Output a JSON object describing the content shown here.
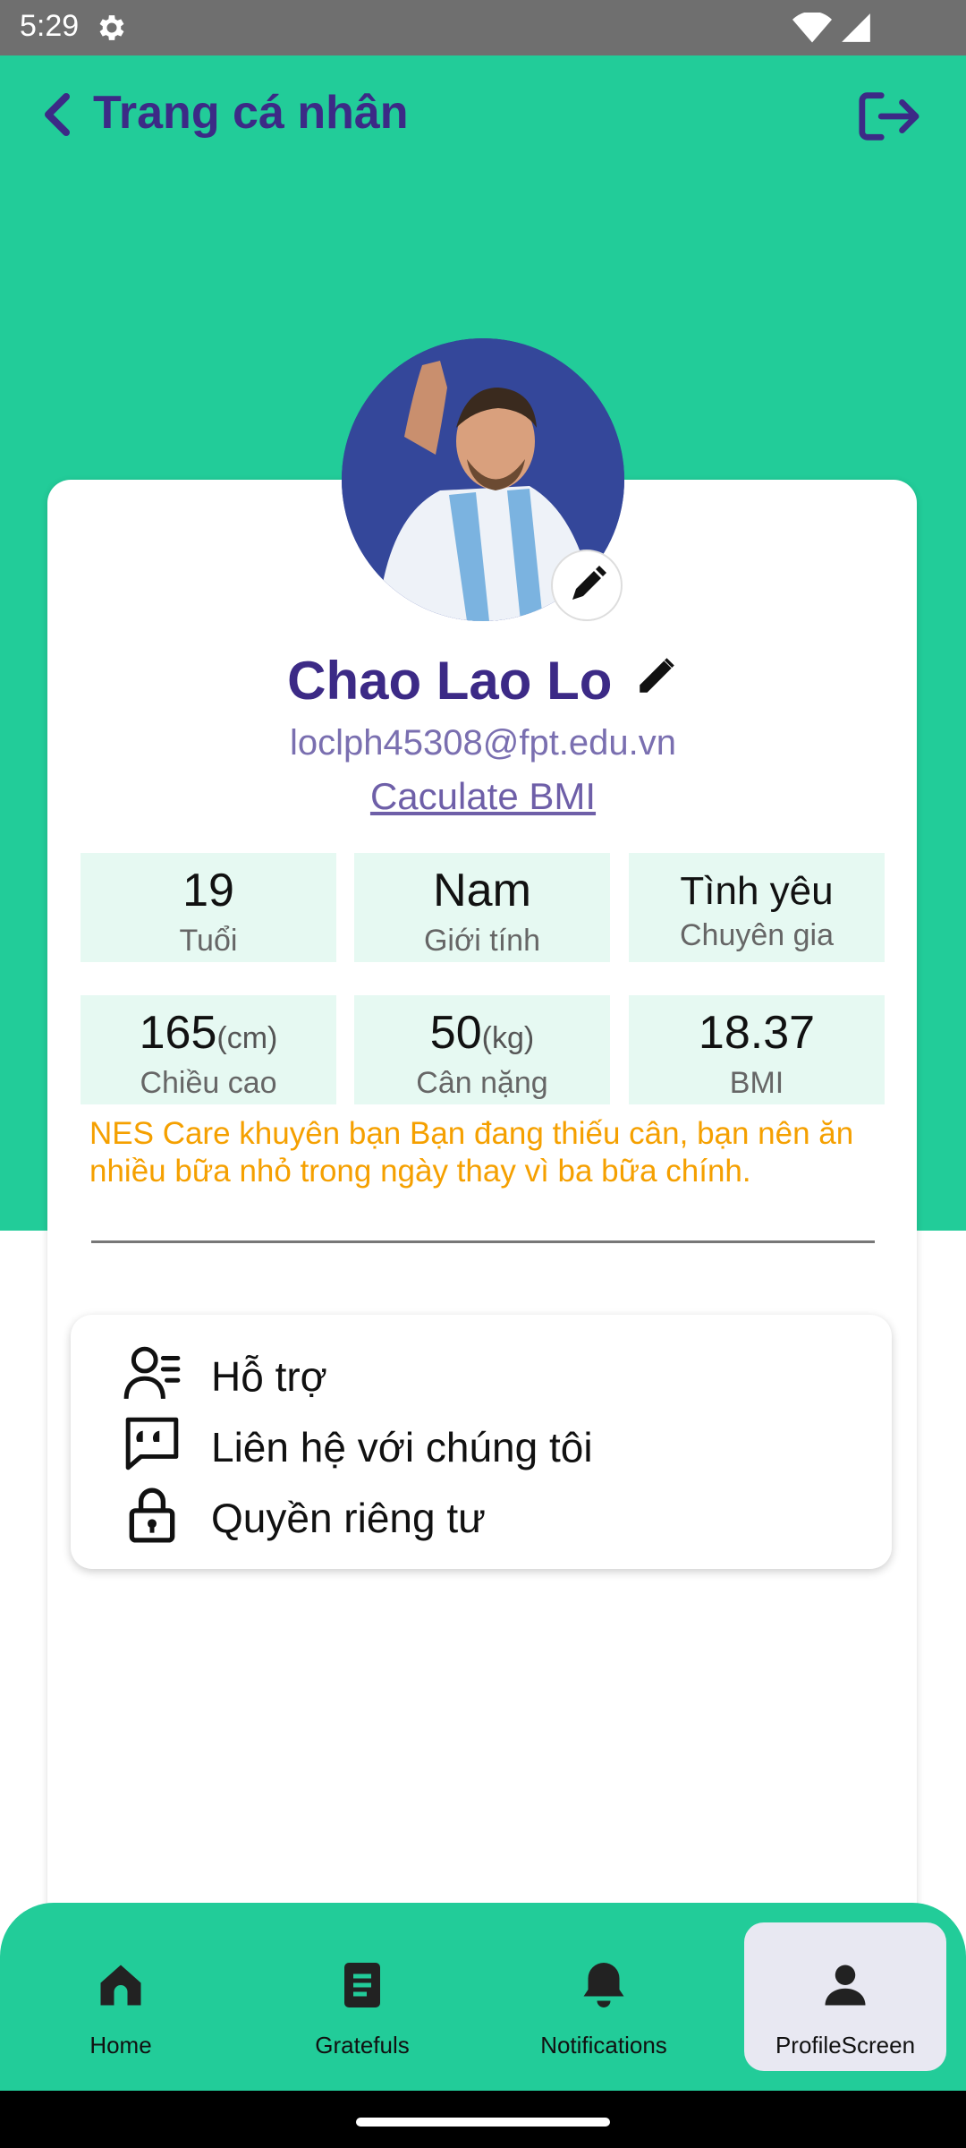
{
  "status_bar": {
    "time": "5:29"
  },
  "header": {
    "title": "Trang cá nhân"
  },
  "profile": {
    "name": "Chao Lao Lo",
    "email": "loclph45308@fpt.edu.vn",
    "bmi_link": "Caculate BMI"
  },
  "stats": [
    {
      "value": "19",
      "unit": "",
      "label": "Tuổi"
    },
    {
      "value": "Nam",
      "unit": "",
      "label": "Giới tính"
    },
    {
      "value": "Tình yêu",
      "unit": "",
      "label": "Chuyên gia"
    },
    {
      "value": "165",
      "unit": "(cm)",
      "label": "Chiều cao"
    },
    {
      "value": "50",
      "unit": "(kg)",
      "label": "Cân nặng"
    },
    {
      "value": "18.37",
      "unit": "",
      "label": "BMI"
    }
  ],
  "advice": "NES Care khuyên bạn Bạn đang thiếu cân, bạn nên ăn nhiều bữa nhỏ trong ngày thay vì ba bữa chính.",
  "menu": [
    {
      "label": "Hỗ trợ",
      "icon": "support-icon"
    },
    {
      "label": "Liên hệ với chúng tôi",
      "icon": "chat-quote-icon"
    },
    {
      "label": "Quyền riêng tư",
      "icon": "lock-icon"
    }
  ],
  "bottom_nav": [
    {
      "label": "Home",
      "icon": "home-icon",
      "active": false
    },
    {
      "label": "Gratefuls",
      "icon": "document-icon",
      "active": false
    },
    {
      "label": "Notifications",
      "icon": "bell-icon",
      "active": false
    },
    {
      "label": "ProfileScreen",
      "icon": "person-icon",
      "active": true
    }
  ],
  "colors": {
    "primary_green": "#22cc99",
    "title_purple": "#3c2a86",
    "advice_orange": "#f5a000",
    "stat_bg": "#e6f9f2"
  }
}
